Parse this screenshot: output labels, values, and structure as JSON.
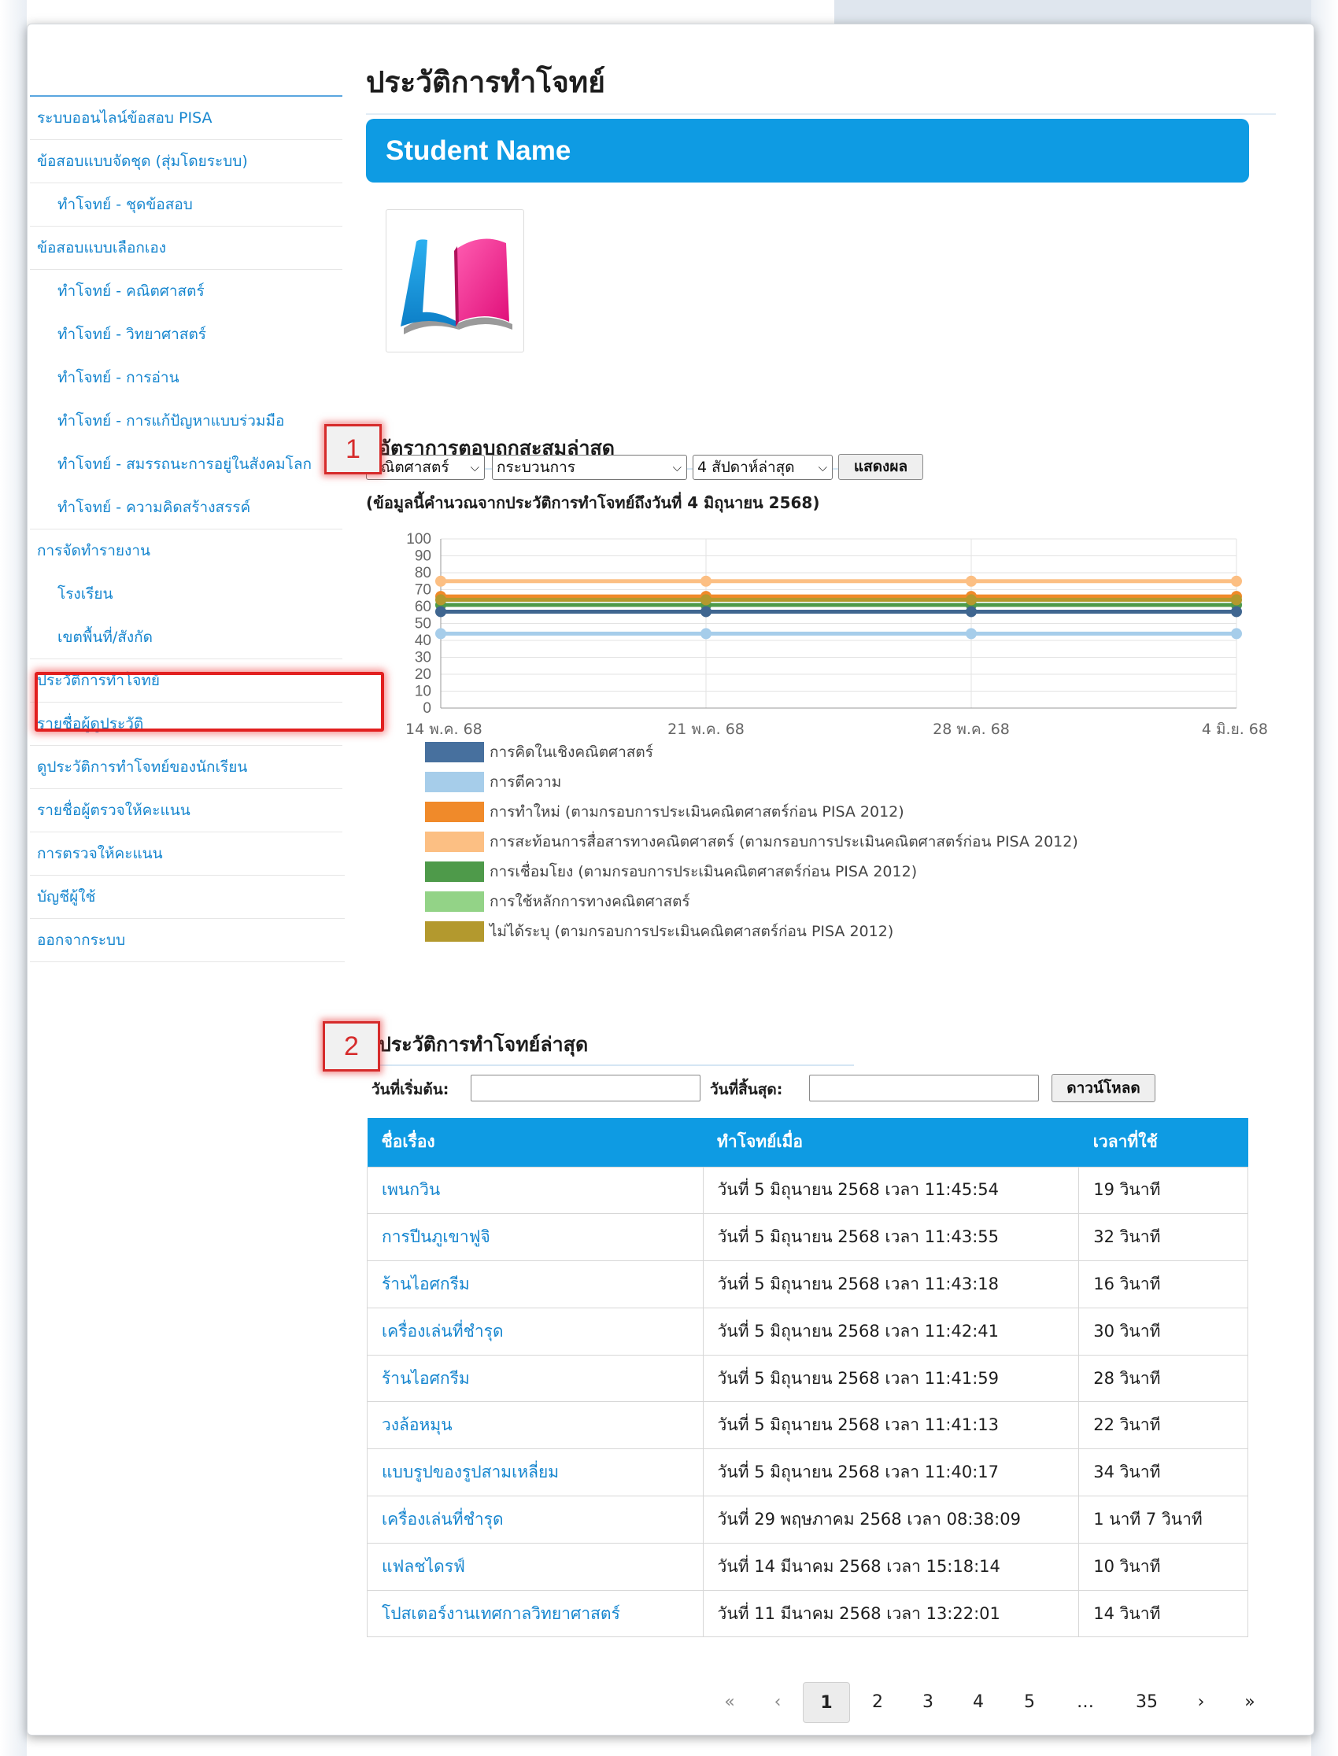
{
  "page_title": "ประวัติการทำโจทย์",
  "student_name": "Student Name",
  "logo": {
    "icon": "open-book-logo-icon",
    "colors": {
      "left": "#1a9be6",
      "right": "#ee1d8a",
      "base": "#9a9a9a"
    }
  },
  "sidebar": {
    "items": [
      {
        "label": "ระบบออนไลน์ข้อสอบ PISA",
        "level": 0
      },
      {
        "label": "ข้อสอบแบบจัดชุด (สุ่มโดยระบบ)",
        "level": 0
      },
      {
        "label": "ทำโจทย์ - ชุดข้อสอบ",
        "level": 1
      },
      {
        "label": "ข้อสอบแบบเลือกเอง",
        "level": 0
      },
      {
        "label": "ทำโจทย์ - คณิตศาสตร์",
        "level": 1
      },
      {
        "label": "ทำโจทย์ - วิทยาศาสตร์",
        "level": 1
      },
      {
        "label": "ทำโจทย์ - การอ่าน",
        "level": 1
      },
      {
        "label": "ทำโจทย์ - การแก้ปัญหาแบบร่วมมือ",
        "level": 1
      },
      {
        "label": "ทำโจทย์ - สมรรถนะการอยู่ในสังคมโลก",
        "level": 1
      },
      {
        "label": "ทำโจทย์ - ความคิดสร้างสรรค์",
        "level": 1
      },
      {
        "label": "การจัดทำรายงาน",
        "level": 0
      },
      {
        "label": "โรงเรียน",
        "level": 1
      },
      {
        "label": "เขตพื้นที่/สังกัด",
        "level": 1
      },
      {
        "label": "ประวัติการทำโจทย์",
        "level": 0,
        "highlighted": true
      },
      {
        "label": "รายชื่อผู้ดูประวัติ",
        "level": 0
      },
      {
        "label": "ดูประวัติการทำโจทย์ของนักเรียน",
        "level": 0
      },
      {
        "label": "รายชื่อผู้ตรวจให้คะแนน",
        "level": 0
      },
      {
        "label": "การตรวจให้คะแนน",
        "level": 0
      },
      {
        "label": "บัญชีผู้ใช้",
        "level": 0
      },
      {
        "label": "ออกจากระบบ",
        "level": 0
      }
    ]
  },
  "accuracy_section": {
    "heading": "อัตราการตอบถูกสะสมล่าสุด",
    "subject_select": "คณิตศาสตร์",
    "process_select": "กระบวนการ",
    "period_select": "4 สัปดาห์ล่าสุด",
    "show_button": "แสดงผล",
    "note": "(ข้อมูลนี้คำนวณจากประวัติการทำโจทย์ถึงวันที่ 4 มิถุนายน 2568)"
  },
  "chart_data": {
    "type": "line",
    "x": [
      "14 พ.ค. 68",
      "21 พ.ค. 68",
      "28 พ.ค. 68",
      "4 มิ.ย. 68"
    ],
    "ylim": [
      0,
      100
    ],
    "yticks": [
      0,
      10,
      20,
      30,
      40,
      50,
      60,
      70,
      80,
      90,
      100
    ],
    "grid": true,
    "legend_position": "bottom",
    "series": [
      {
        "name": "การคิดในเชิงคณิตศาสตร์",
        "color": "#47709e",
        "values": [
          null,
          null,
          null,
          null
        ]
      },
      {
        "name": "การตีความ",
        "color": "#a6cdea",
        "values": [
          44,
          44,
          44,
          44
        ]
      },
      {
        "name": "การทำใหม่ (ตามกรอบการประเมินคณิตศาสตร์ก่อน PISA 2012)",
        "color": "#f08a2a",
        "values": [
          66,
          66,
          66,
          66
        ]
      },
      {
        "name": "การสะท้อนการสื่อสารทางคณิตศาสตร์ (ตามกรอบการประเมินคณิตศาสตร์ก่อน PISA 2012)",
        "color": "#fcbf83",
        "values": [
          75,
          75,
          75,
          75
        ]
      },
      {
        "name": "การเชื่อมโยง (ตามกรอบการประเมินคณิตศาสตร์ก่อน PISA 2012)",
        "color": "#4e9a4a",
        "values": [
          61,
          61,
          61,
          61
        ]
      },
      {
        "name": "การใช้หลักการทางคณิตศาสตร์",
        "color": "#93d387",
        "values": [
          null,
          null,
          null,
          null
        ]
      },
      {
        "name": "ไม่ได้ระบุ (ตามกรอบการประเมินคณิตศาสตร์ก่อน PISA 2012)",
        "color": "#b3992e",
        "values": [
          64,
          64,
          64,
          64
        ]
      },
      {
        "name": "",
        "color": "#3f6690",
        "values": [
          57,
          57,
          57,
          57
        ]
      }
    ]
  },
  "history_section": {
    "heading": "ประวัติการทำโจทย์ล่าสุด",
    "start_label": "วันที่เริ่มต้น:",
    "start_value": "",
    "end_label": "วันที่สิ้นสุด:",
    "end_value": "",
    "download_button": "ดาวน์โหลด"
  },
  "table": {
    "headers": [
      "ชื่อเรื่อง",
      "ทำโจทย์เมื่อ",
      "เวลาที่ใช้"
    ],
    "rows": [
      [
        "เพนกวิน",
        "วันที่ 5 มิถุนายน 2568 เวลา 11:45:54",
        "19 วินาที"
      ],
      [
        "การปีนภูเขาฟูจิ",
        "วันที่ 5 มิถุนายน 2568 เวลา 11:43:55",
        "32 วินาที"
      ],
      [
        "ร้านไอศกรีม",
        "วันที่ 5 มิถุนายน 2568 เวลา 11:43:18",
        "16 วินาที"
      ],
      [
        "เครื่องเล่นที่ชำรุด",
        "วันที่ 5 มิถุนายน 2568 เวลา 11:42:41",
        "30 วินาที"
      ],
      [
        "ร้านไอศกรีม",
        "วันที่ 5 มิถุนายน 2568 เวลา 11:41:59",
        "28 วินาที"
      ],
      [
        "วงล้อหมุน",
        "วันที่ 5 มิถุนายน 2568 เวลา 11:41:13",
        "22 วินาที"
      ],
      [
        "แบบรูปของรูปสามเหลี่ยม",
        "วันที่ 5 มิถุนายน 2568 เวลา 11:40:17",
        "34 วินาที"
      ],
      [
        "เครื่องเล่นที่ชำรุด",
        "วันที่ 29 พฤษภาคม 2568 เวลา 08:38:09",
        "1 นาที 7 วินาที"
      ],
      [
        "แฟลชไดรฟ์",
        "วันที่ 14 มีนาคม 2568 เวลา 15:18:14",
        "10 วินาที"
      ],
      [
        "โปสเตอร์งานเทศกาลวิทยาศาสตร์",
        "วันที่ 11 มีนาคม 2568 เวลา 13:22:01",
        "14 วินาที"
      ]
    ]
  },
  "pagination": {
    "first": "«",
    "prev": "‹",
    "pages": [
      "1",
      "2",
      "3",
      "4",
      "5"
    ],
    "ellipsis": "…",
    "last_page": "35",
    "next": "›",
    "last": "»",
    "current": "1"
  },
  "annotations": {
    "callout_1": "1",
    "callout_2": "2"
  }
}
